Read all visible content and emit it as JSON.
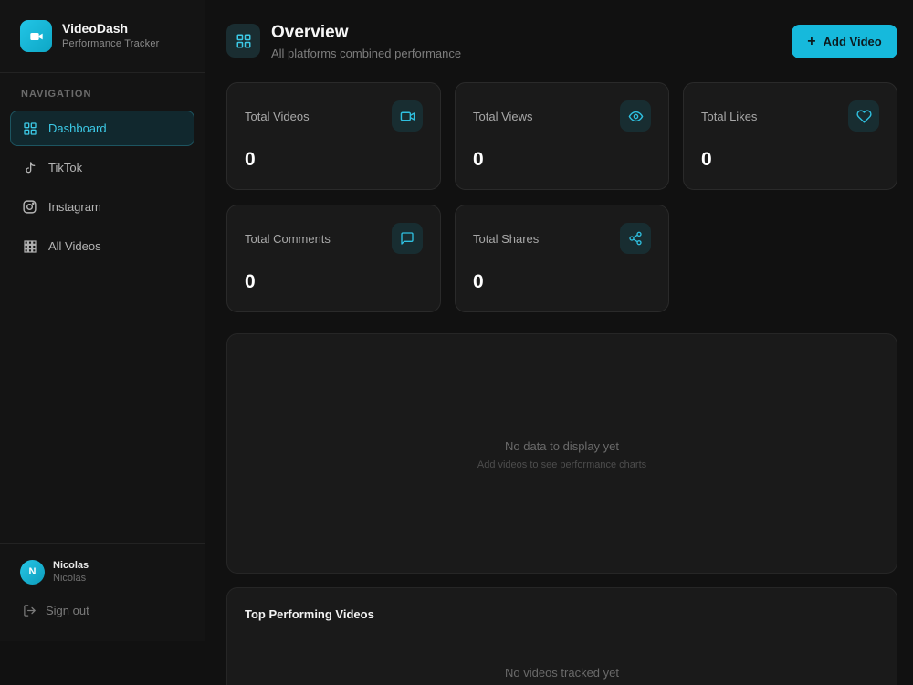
{
  "brand": {
    "title": "VideoDash",
    "subtitle": "Performance Tracker"
  },
  "sidebar": {
    "section_label": "NAVIGATION",
    "items": [
      {
        "label": "Dashboard",
        "icon": "dashboard-grid-icon",
        "active": true
      },
      {
        "label": "TikTok",
        "icon": "tiktok-icon",
        "active": false
      },
      {
        "label": "Instagram",
        "icon": "instagram-icon",
        "active": false
      },
      {
        "label": "All Videos",
        "icon": "all-videos-grid-icon",
        "active": false
      }
    ]
  },
  "user": {
    "initial": "N",
    "name": "Nicolas",
    "secondary": "Nicolas",
    "signout_label": "Sign out"
  },
  "header": {
    "title": "Overview",
    "subtitle": "All platforms combined performance",
    "add_button_label": "Add Video"
  },
  "stats": [
    {
      "label": "Total Videos",
      "value": "0",
      "icon": "video-camera-icon"
    },
    {
      "label": "Total Views",
      "value": "0",
      "icon": "eye-icon"
    },
    {
      "label": "Total Likes",
      "value": "0",
      "icon": "heart-icon"
    },
    {
      "label": "Total Comments",
      "value": "0",
      "icon": "comment-icon"
    },
    {
      "label": "Total Shares",
      "value": "0",
      "icon": "share-icon"
    }
  ],
  "chart_panel": {
    "empty_title": "No data to display yet",
    "empty_subtitle": "Add videos to see performance charts"
  },
  "top_videos": {
    "title": "Top Performing Videos",
    "empty_text": "No videos tracked yet"
  },
  "colors": {
    "accent": "#16b9dc",
    "background": "#111111",
    "card": "#1a1a1a",
    "active_nav_bg": "#11282e"
  }
}
